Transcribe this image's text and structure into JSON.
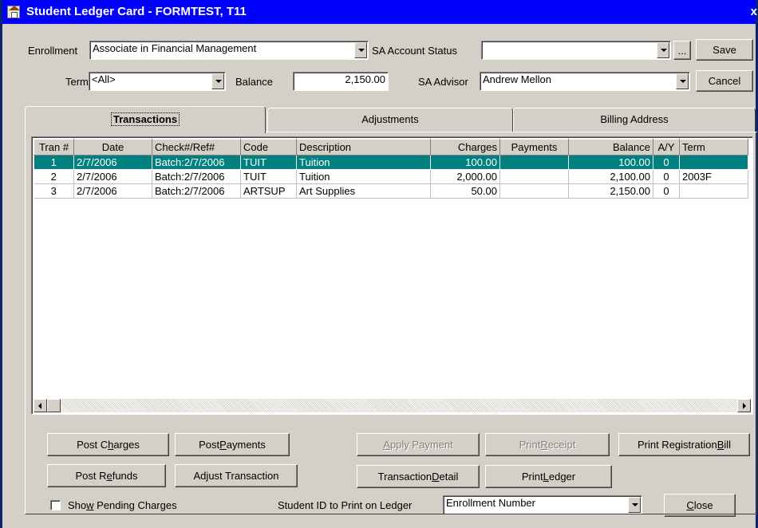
{
  "window": {
    "title": "Student Ledger Card - FORMTEST, T11",
    "close_glyph": "x"
  },
  "form": {
    "enrollment_label": "Enrollment",
    "enrollment_value": "Associate in Financial Management",
    "sa_account_status_label": "SA Account Status",
    "sa_account_status_value": "",
    "ellipsis_label": "...",
    "save_label": "Save",
    "term_label": "Term",
    "term_value": "<All>",
    "balance_label": "Balance",
    "balance_value": "2,150.00",
    "sa_advisor_label": "SA Advisor",
    "sa_advisor_value": "Andrew Mellon",
    "cancel_label": "Cancel"
  },
  "tabs": [
    {
      "label": "Transactions",
      "active": true
    },
    {
      "label": "Adjustments",
      "active": false
    },
    {
      "label": "Billing Address",
      "active": false
    }
  ],
  "grid": {
    "columns": [
      "Tran #",
      "Date",
      "Check#/Ref#",
      "Code",
      "Description",
      "Charges",
      "Payments",
      "Balance",
      "A/Y",
      "Term"
    ],
    "rows": [
      {
        "tran": "1",
        "date": "2/7/2006",
        "ref": "Batch:2/7/2006",
        "code": "TUIT",
        "description": "Tuition",
        "charges": "100.00",
        "payments": "",
        "balance": "100.00",
        "ay": "0",
        "term": "",
        "selected": true
      },
      {
        "tran": "2",
        "date": "2/7/2006",
        "ref": "Batch:2/7/2006",
        "code": "TUIT",
        "description": "Tuition",
        "charges": "2,000.00",
        "payments": "",
        "balance": "2,100.00",
        "ay": "0",
        "term": "2003F",
        "selected": false
      },
      {
        "tran": "3",
        "date": "2/7/2006",
        "ref": "Batch:2/7/2006",
        "code": "ARTSUP",
        "description": "Art Supplies",
        "charges": "50.00",
        "payments": "",
        "balance": "2,150.00",
        "ay": "0",
        "term": "",
        "selected": false
      }
    ]
  },
  "buttons": {
    "post_charges": {
      "pre": "Post C",
      "key": "h",
      "post": "arges"
    },
    "post_payments": {
      "pre": "Post ",
      "key": "P",
      "post": "ayments"
    },
    "apply_payment": {
      "pre": "",
      "key": "A",
      "post": "pply Payment"
    },
    "print_receipt": {
      "pre": "Print ",
      "key": "R",
      "post": "eceipt"
    },
    "print_registration_bill": {
      "pre": "Print Registration ",
      "key": "B",
      "post": "ill"
    },
    "post_refunds": {
      "pre": "Post R",
      "key": "e",
      "post": "funds"
    },
    "adjust_transaction": {
      "pre": "Ad",
      "key": "j",
      "post": "ust Transaction"
    },
    "transaction_detail": {
      "pre": "Transaction ",
      "key": "D",
      "post": "etail"
    },
    "print_ledger": {
      "pre": "Print ",
      "key": "L",
      "post": "edger"
    },
    "close": {
      "pre": "",
      "key": "C",
      "post": "lose"
    }
  },
  "footer": {
    "show_pending_pre": "Sho",
    "show_pending_key": "w",
    "show_pending_post": " Pending Charges",
    "show_pending_checked": false,
    "student_id_label": "Student ID to Print on Ledger",
    "student_id_value": "Enrollment Number"
  }
}
